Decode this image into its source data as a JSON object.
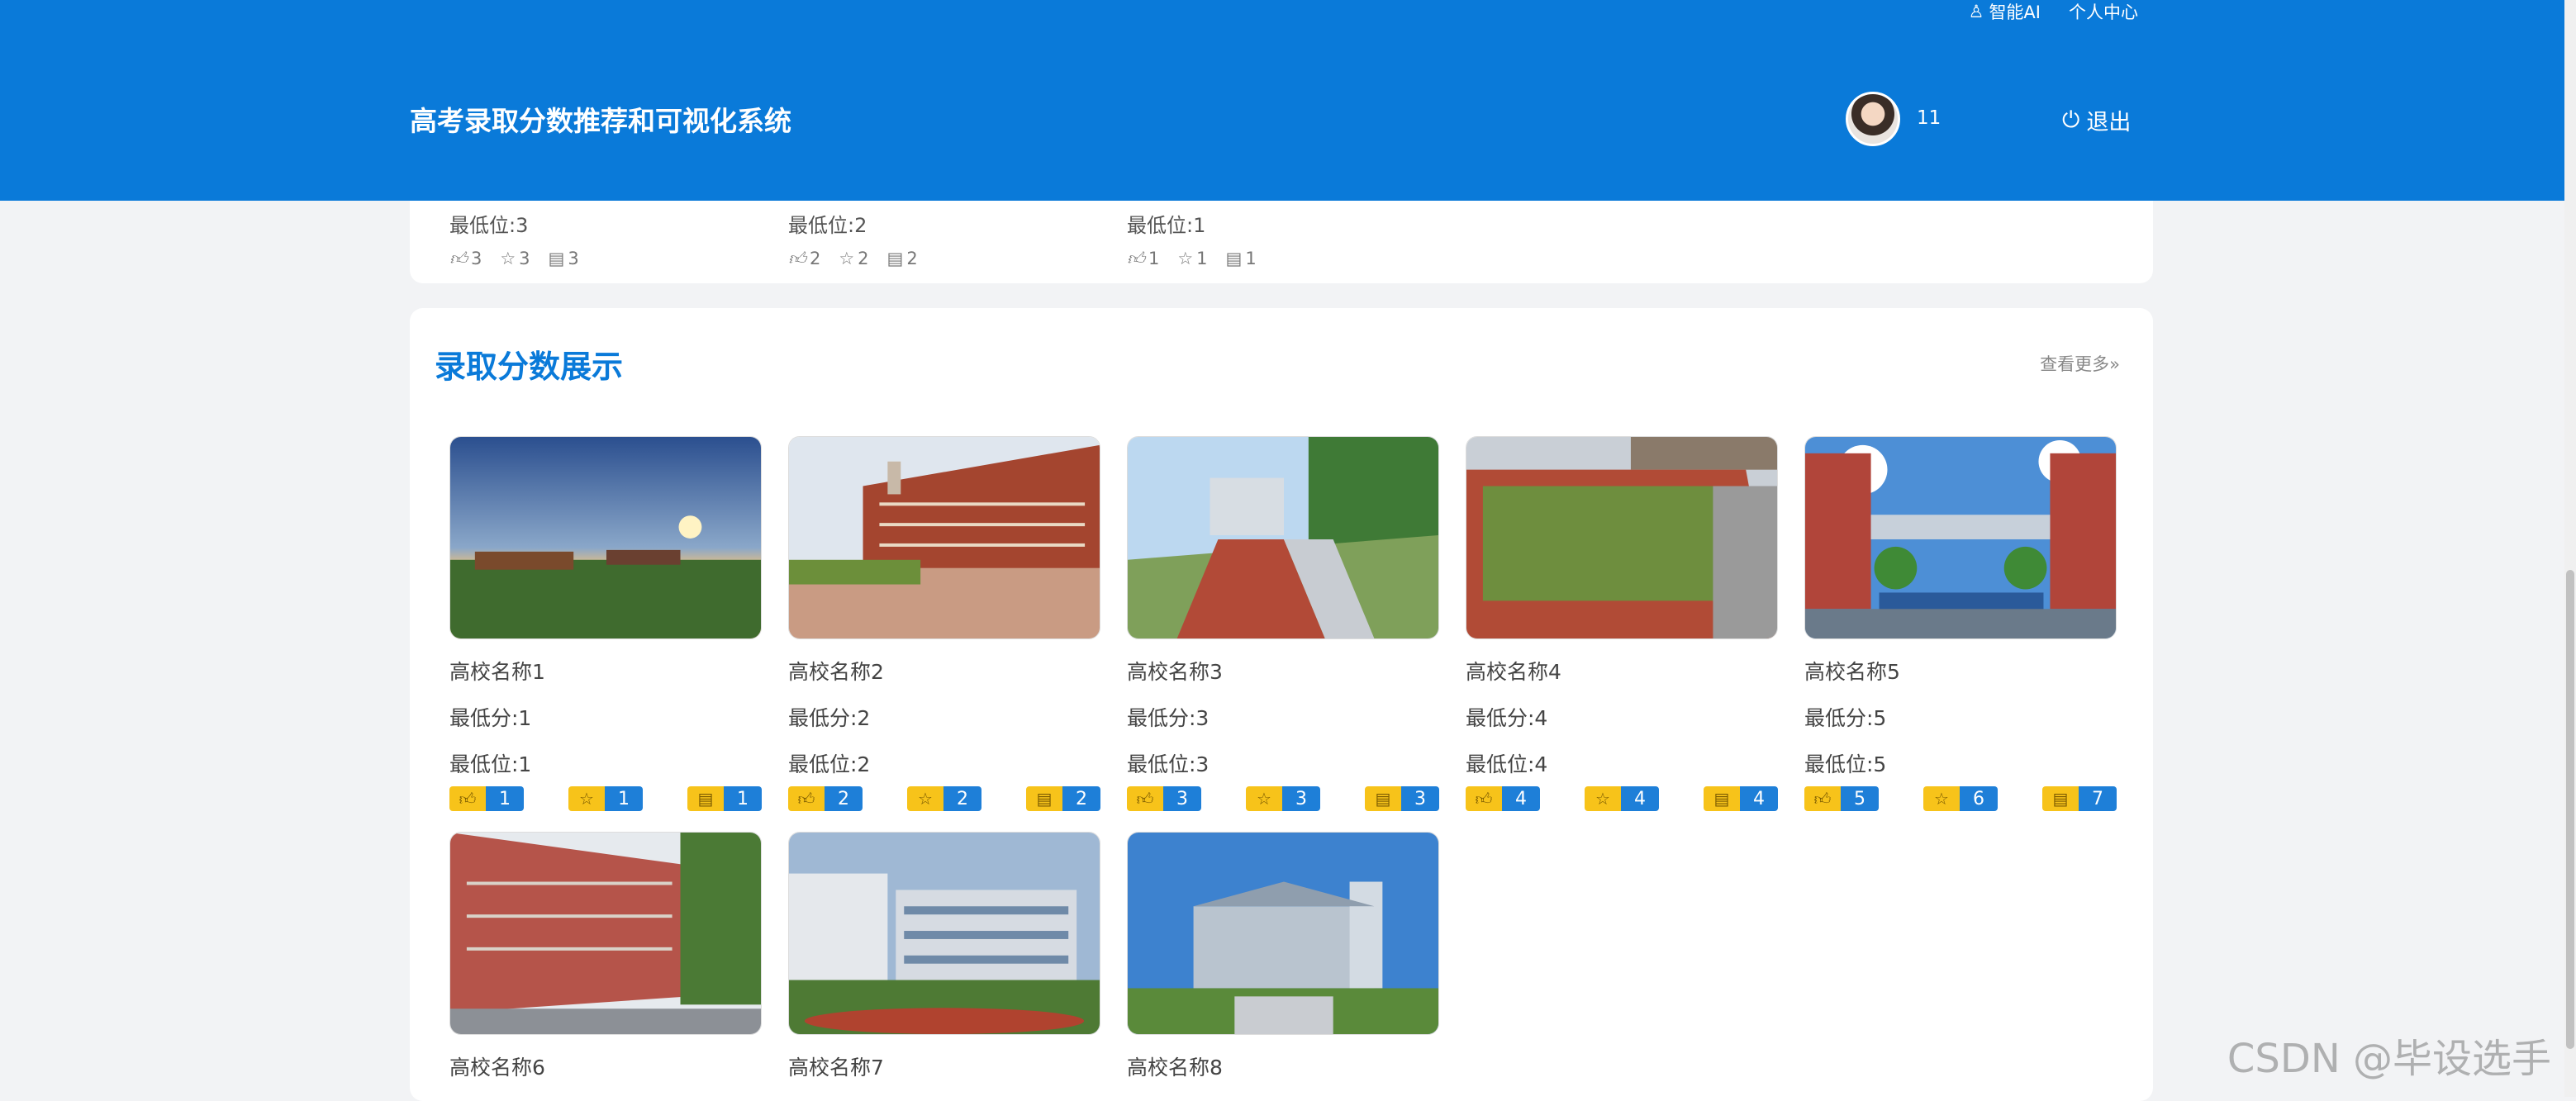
{
  "topbar": {
    "ai_label": "智能AI",
    "profile_label": "个人中心"
  },
  "header": {
    "title": "高考录取分数推荐和可视化系统",
    "username": "11",
    "logout_label": "退出"
  },
  "prev_items": [
    {
      "pos": "最低位:3",
      "likes": "3",
      "favs": "3",
      "comments": "3"
    },
    {
      "pos": "最低位:2",
      "likes": "2",
      "favs": "2",
      "comments": "2"
    },
    {
      "pos": "最低位:1",
      "likes": "1",
      "favs": "1",
      "comments": "1"
    }
  ],
  "section": {
    "title": "录取分数展示",
    "more_label": "查看更多»"
  },
  "cards": [
    {
      "name": "高校名称1",
      "score": "最低分:1",
      "rank": "最低位:1",
      "likes": "1",
      "favs": "1",
      "comments": "1",
      "scene": "sunset-field"
    },
    {
      "name": "高校名称2",
      "score": "最低分:2",
      "rank": "最低位:2",
      "likes": "2",
      "favs": "2",
      "comments": "2",
      "scene": "brick-building"
    },
    {
      "name": "高校名称3",
      "score": "最低分:3",
      "rank": "最低位:3",
      "likes": "3",
      "favs": "3",
      "comments": "3",
      "scene": "running-track"
    },
    {
      "name": "高校名称4",
      "score": "最低分:4",
      "rank": "最低位:4",
      "likes": "4",
      "favs": "4",
      "comments": "4",
      "scene": "sports-field"
    },
    {
      "name": "高校名称5",
      "score": "最低分:5",
      "rank": "最低位:5",
      "likes": "5",
      "favs": "6",
      "comments": "7",
      "scene": "campus-bridge"
    },
    {
      "name": "高校名称6",
      "scene": "red-dorm"
    },
    {
      "name": "高校名称7",
      "scene": "modern-campus"
    },
    {
      "name": "高校名称8",
      "scene": "blue-sky-hall"
    }
  ],
  "watermark": "CSDN @毕设选手",
  "colors": {
    "primary": "#0a7ad9",
    "badge_yellow": "#f7c31a",
    "badge_blue": "#1e7fd8"
  }
}
